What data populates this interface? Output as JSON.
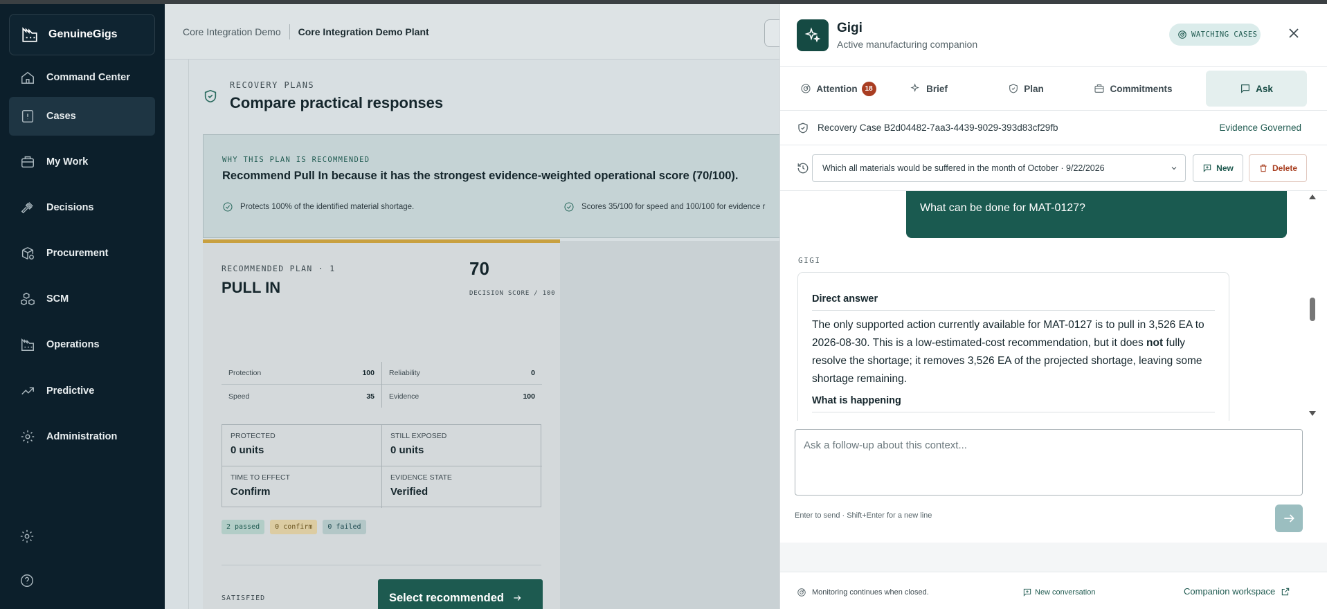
{
  "app": {
    "brand": "GenuineGigs"
  },
  "sidebar": {
    "items": [
      {
        "label": "Command Center",
        "icon": "home-icon"
      },
      {
        "label": "Cases",
        "icon": "alert-file-icon"
      },
      {
        "label": "My Work",
        "icon": "briefcase-icon"
      },
      {
        "label": "Decisions",
        "icon": "gavel-icon"
      },
      {
        "label": "Procurement",
        "icon": "package-search-icon"
      },
      {
        "label": "SCM",
        "icon": "boxes-icon"
      },
      {
        "label": "Operations",
        "icon": "factory-icon"
      },
      {
        "label": "Predictive",
        "icon": "trend-up-icon"
      },
      {
        "label": "Administration",
        "icon": "gear-icon"
      }
    ]
  },
  "topbar": {
    "crumb1": "Core Integration Demo",
    "crumb2": "Core Integration Demo Plant"
  },
  "recovery": {
    "eyebrow": "RECOVERY PLANS",
    "title": "Compare practical responses"
  },
  "why": {
    "eyebrow": "WHY THIS PLAN IS RECOMMENDED",
    "title": "Recommend Pull In because it has the strongest evidence-weighted operational score (70/100).",
    "point1": "Protects 100% of the identified material shortage.",
    "point2": "Scores 35/100 for speed and 100/100 for evidence r"
  },
  "plan": {
    "eyebrow": "RECOMMENDED PLAN · 1",
    "title": "PULL IN",
    "score": "70",
    "score_label": "DECISION SCORE / 100",
    "metrics": {
      "protection_label": "Protection",
      "protection": "100",
      "reliability_label": "Reliability",
      "reliability": "0",
      "speed_label": "Speed",
      "speed": "35",
      "evidence_label": "Evidence",
      "evidence": "100"
    },
    "protected_label": "PROTECTED",
    "protected": "0 units",
    "exposed_label": "STILL EXPOSED",
    "exposed": "0 units",
    "time_label": "TIME TO EFFECT",
    "time": "Confirm",
    "evstate_label": "EVIDENCE STATE",
    "evstate": "Verified",
    "chip_passed": "2 passed",
    "chip_confirm": "0 confirm",
    "chip_failed": "0 failed",
    "satisfied": "SATISFIED",
    "select_btn": "Select recommended"
  },
  "panel": {
    "name": "Gigi",
    "subtitle": "Active manufacturing companion",
    "watching": "WATCHING CASES",
    "tabs": [
      {
        "label": "Attention",
        "badge": "18"
      },
      {
        "label": "Brief"
      },
      {
        "label": "Plan"
      },
      {
        "label": "Commitments"
      },
      {
        "label": "Ask"
      }
    ],
    "case": "Recovery Case B2d04482-7aa3-4439-9029-393d83cf29fb",
    "evidence": "Evidence Governed",
    "conversation": "Which all materials would be suffered in the month of October · 9/22/2026",
    "new_btn": "New",
    "delete_btn": "Delete",
    "user_msg": "What can be done for MAT-0127?",
    "gigi_label": "GIGI",
    "answer_heading": "Direct answer",
    "answer_p1": "The only supported action currently available for MAT-0127 is to pull in 3,526 EA to 2026-08-30. This is a low-estimated-cost recommendation, but it does ",
    "answer_bold": "not",
    "answer_p2": " fully resolve the shortage; it removes 3,526 EA of the projected shortage, leaving some shortage remaining.",
    "answer_heading2": "What is happening",
    "composer_placeholder": "Ask a follow-up about this context...",
    "hint": "Enter to send · Shift+Enter for a new line",
    "footer_monitor": "Monitoring continues when closed.",
    "footer_new": "New conversation",
    "footer_workspace": "Companion workspace"
  }
}
